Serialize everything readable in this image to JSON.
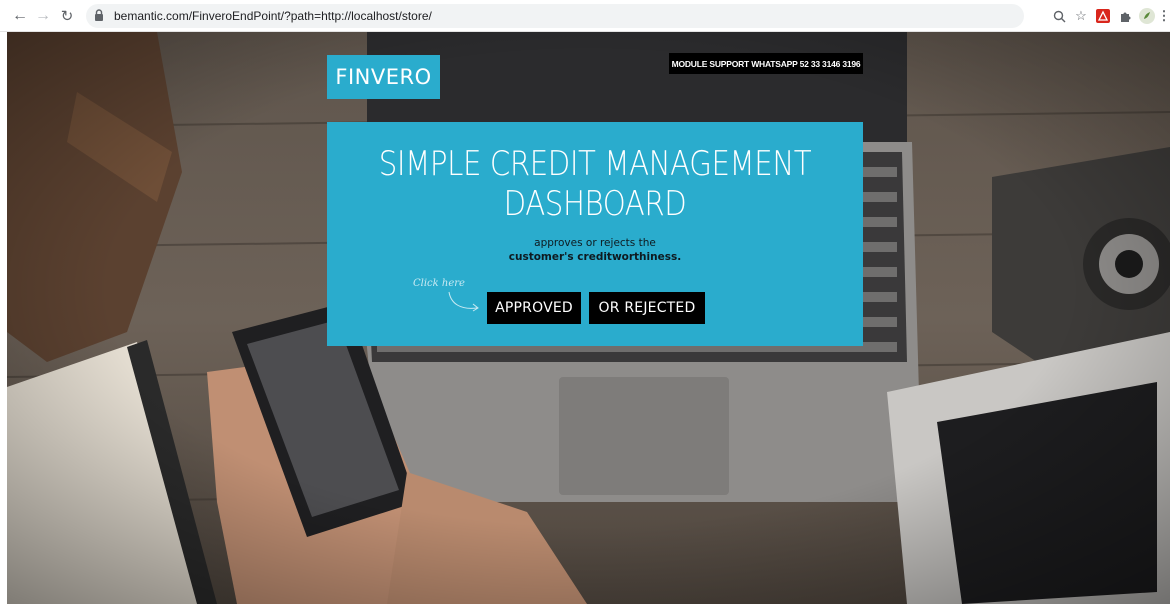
{
  "browser": {
    "url": "bemantic.com/FinveroEndPoint/?path=http://localhost/store/"
  },
  "header": {
    "logo": "FINVERO",
    "support": "MODULE SUPPORT WHATSAPP 52 33 3146 3196"
  },
  "hero": {
    "title_line1": "SIMPLE CREDIT MANAGEMENT",
    "title_line2": "DASHBOARD",
    "subtitle_line1": "approves or rejects the",
    "subtitle_line2": "customer's creditworthiness.",
    "click_hint": "Click here",
    "approved_label": "APPROVED",
    "rejected_label": "OR REJECTED"
  },
  "colors": {
    "accent": "#2aaccd",
    "button_bg": "#000000"
  }
}
